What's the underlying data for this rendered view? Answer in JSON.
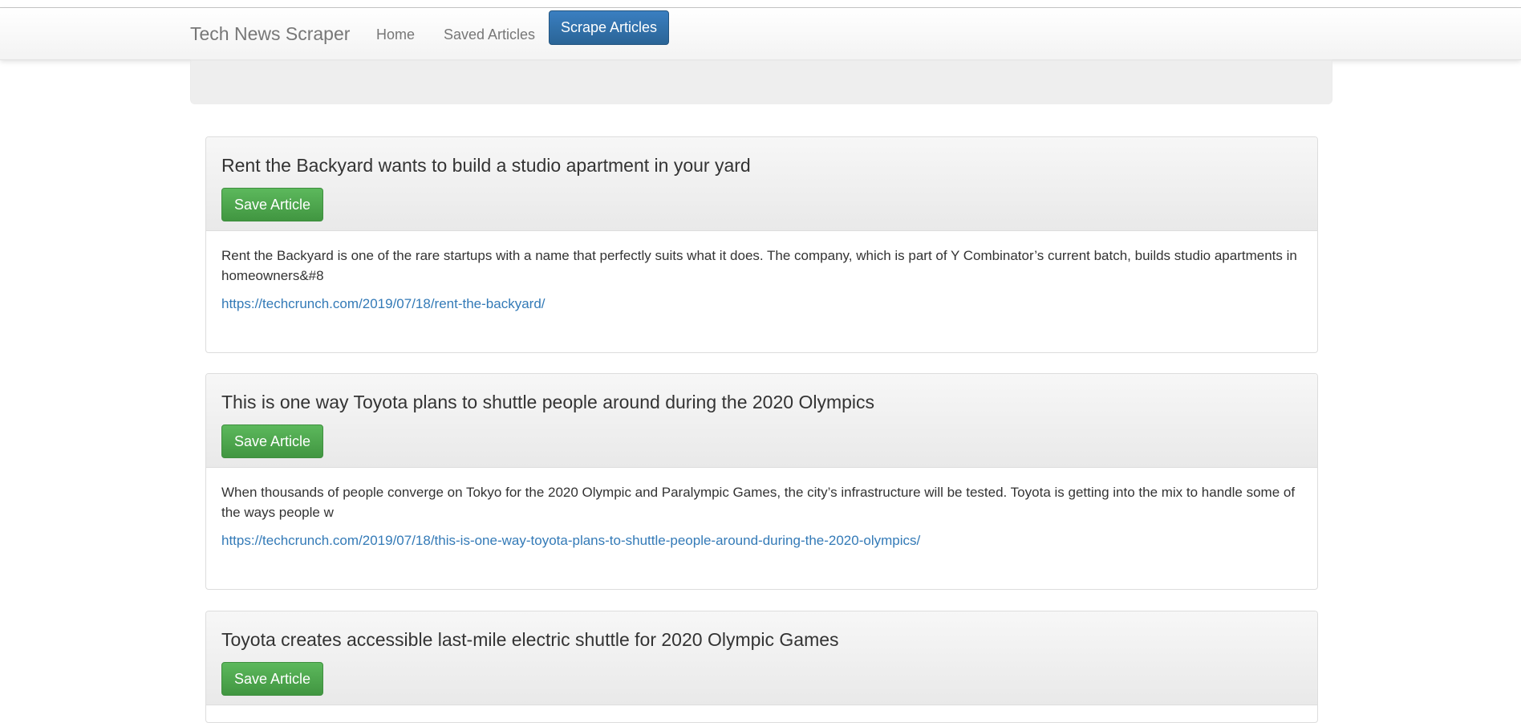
{
  "navbar": {
    "brand": "Tech News Scraper",
    "links": [
      {
        "label": "Home"
      },
      {
        "label": "Saved Articles"
      }
    ],
    "scrape_button": "Scrape Articles"
  },
  "articles": [
    {
      "title": "Rent the Backyard wants to build a studio apartment in your yard",
      "save_label": "Save Article",
      "summary": "Rent the Backyard is one of the rare startups with a name that perfectly suits what it does. The company, which is part of Y Combinator’s current batch, builds studio apartments in homeowners&#8",
      "link": "https://techcrunch.com/2019/07/18/rent-the-backyard/"
    },
    {
      "title": "This is one way Toyota plans to shuttle people around during the 2020 Olympics",
      "save_label": "Save Article",
      "summary": "When thousands of people converge on Tokyo for the 2020 Olympic and Paralympic Games, the city’s infrastructure will be tested. Toyota is getting into the mix to handle some of the ways people w",
      "link": "https://techcrunch.com/2019/07/18/this-is-one-way-toyota-plans-to-shuttle-people-around-during-the-2020-olympics/"
    },
    {
      "title": "Toyota creates accessible last-mile electric shuttle for 2020 Olympic Games",
      "save_label": "Save Article"
    }
  ],
  "colors": {
    "primary": "#2a6496",
    "success": "#5cb85c",
    "link": "#337ab7"
  }
}
